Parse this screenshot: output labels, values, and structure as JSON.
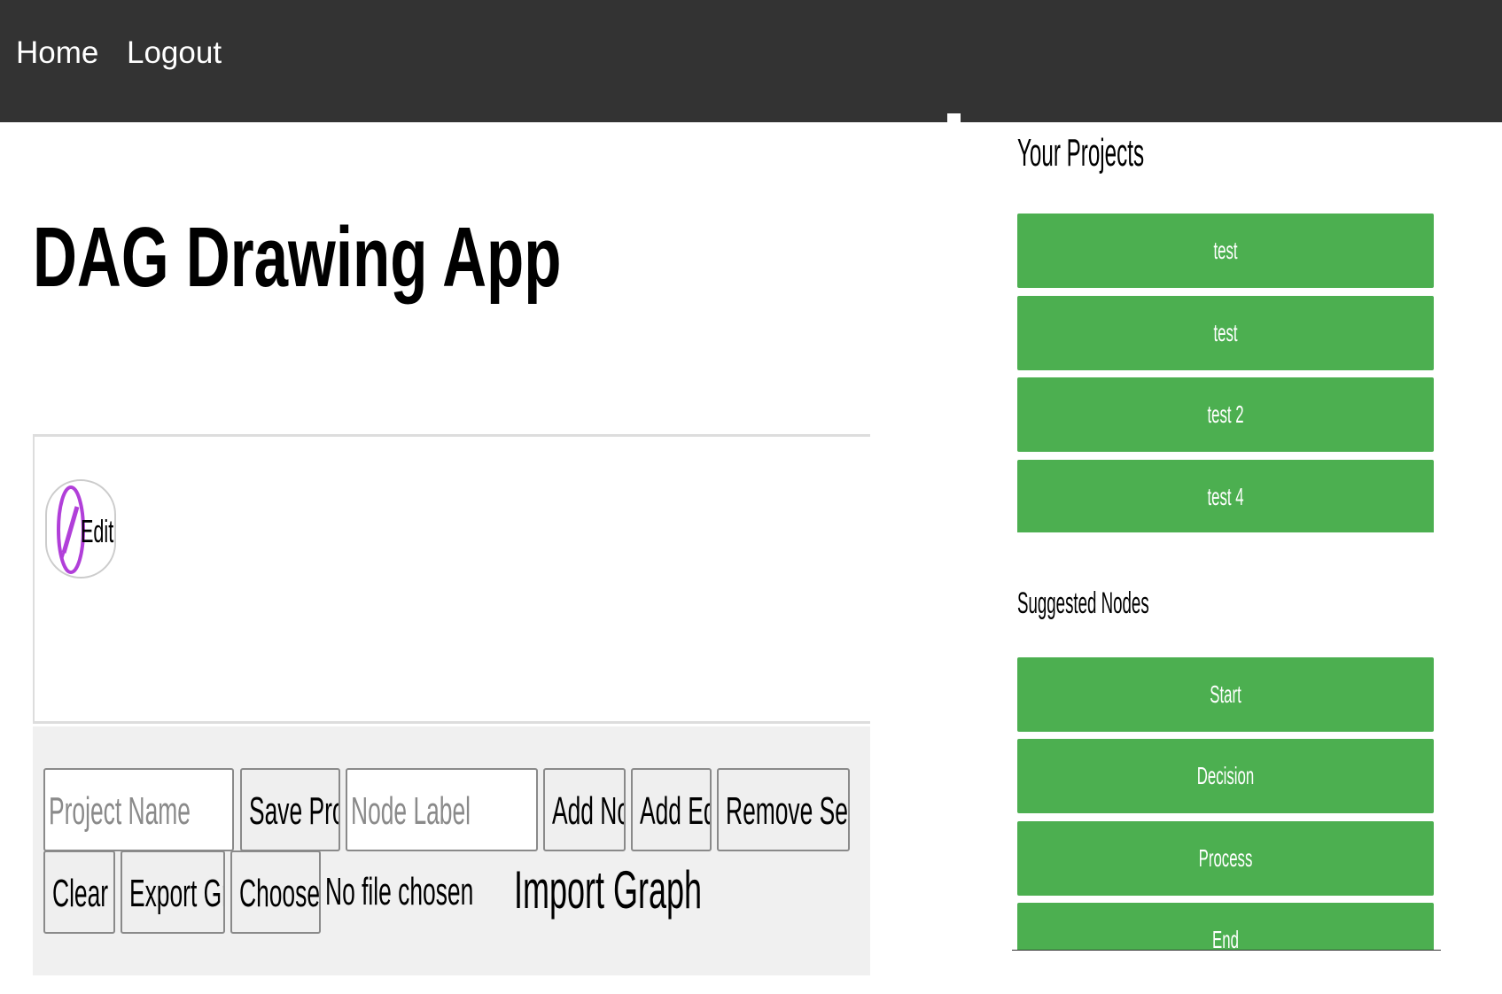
{
  "nav": {
    "home": "Home",
    "logout": "Logout"
  },
  "page_title": "DAG Drawing App",
  "canvas": {
    "edit_label": "Edit"
  },
  "controls": {
    "project_name_placeholder": "Project Name",
    "save_project": "Save Project",
    "node_label_placeholder": "Node Label",
    "add_node": "Add Node",
    "add_edge": "Add Edge",
    "remove_selected": "Remove Selected",
    "clear_all": "Clear All",
    "export_graph": "Export Graph",
    "choose_file": "Choose file",
    "no_file_chosen": "No file chosen",
    "import_graph": "Import Graph"
  },
  "sidebar": {
    "projects_heading": "Your Projects",
    "projects": [
      "test",
      "test",
      "test 2",
      "test 4"
    ],
    "suggested_heading": "Suggested Nodes",
    "suggested": [
      "Start",
      "Decision",
      "Process",
      "End"
    ]
  },
  "colors": {
    "navbar_bg": "#333333",
    "button_green": "#4caf50",
    "edit_icon_purple": "#b13fd9",
    "controls_bg": "#f0f0f0"
  },
  "icons": {
    "edit": "pencil-circle-icon"
  }
}
